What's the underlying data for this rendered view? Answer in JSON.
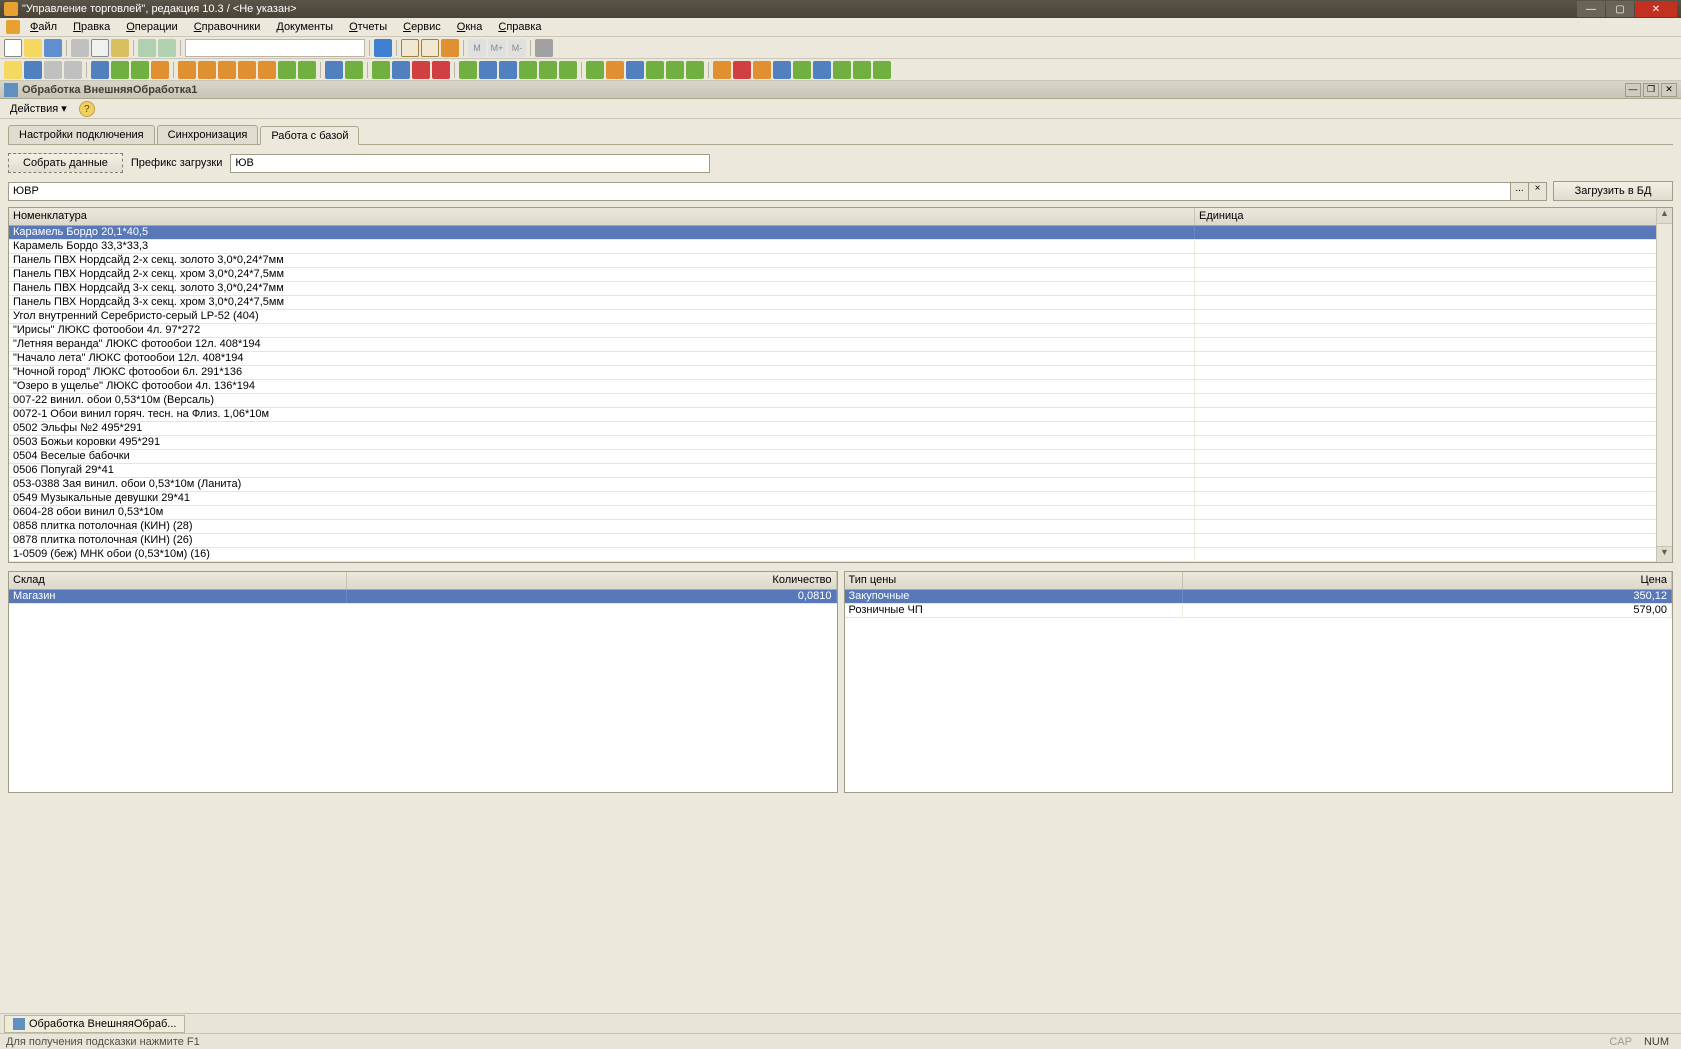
{
  "window": {
    "title": "\"Управление торговлей\", редакция 10.3 / <Не указан>"
  },
  "menu": [
    "Файл",
    "Правка",
    "Операции",
    "Справочники",
    "Документы",
    "Отчеты",
    "Сервис",
    "Окна",
    "Справка"
  ],
  "subwindow": {
    "title": "Обработка  ВнешняяОбработка1"
  },
  "actions": {
    "label": "Действия"
  },
  "tabs": [
    {
      "label": "Настройки подключения",
      "active": false
    },
    {
      "label": "Синхронизация",
      "active": false
    },
    {
      "label": "Работа с базой",
      "active": true
    }
  ],
  "form": {
    "collect_btn": "Собрать данные",
    "prefix_label": "Префикс загрузки",
    "prefix_value": "ЮВ",
    "group_value": "ЮВР",
    "load_btn": "Загрузить в БД"
  },
  "nomenclature": {
    "headers": {
      "name": "Номенклатура",
      "unit": "Единица"
    },
    "rows": [
      {
        "name": "Карамель Бордо 20,1*40,5",
        "selected": true
      },
      {
        "name": "Карамель Бордо 33,3*33,3"
      },
      {
        "name": "Панель ПВХ Нордсайд 2-х секц. золото 3,0*0,24*7мм"
      },
      {
        "name": "Панель ПВХ Нордсайд 2-х секц. хром 3,0*0,24*7,5мм"
      },
      {
        "name": "Панель ПВХ Нордсайд 3-х секц. золото 3,0*0,24*7мм"
      },
      {
        "name": "Панель ПВХ Нордсайд 3-х секц. хром 3,0*0,24*7,5мм"
      },
      {
        "name": "Угол внутренний Серебристо-серый LP-52 (404)"
      },
      {
        "name": "\"Ирисы\" ЛЮКС  фотообои 4л. 97*272"
      },
      {
        "name": "\"Летняя веранда\" ЛЮКС фотообои 12л. 408*194"
      },
      {
        "name": "\"Начало лета\" ЛЮКС фотообои 12л. 408*194"
      },
      {
        "name": "\"Ночной город\" ЛЮКС  фотообои 6л. 291*136"
      },
      {
        "name": "\"Озеро в ущелье\" ЛЮКС  фотообои 4л. 136*194"
      },
      {
        "name": "007-22 винил. обои 0,53*10м (Версаль)"
      },
      {
        "name": "0072-1 Обои винил горяч. тесн. на Флиз. 1,06*10м"
      },
      {
        "name": "0502 Эльфы №2 495*291"
      },
      {
        "name": "0503 Божьи коровки 495*291"
      },
      {
        "name": "0504 Веселые бабочки"
      },
      {
        "name": "0506 Попугай 29*41"
      },
      {
        "name": "053-0388 Зая винил. обои 0,53*10м (Ланита)"
      },
      {
        "name": "0549 Музыкальные девушки 29*41"
      },
      {
        "name": "0604-28 обои винил 0,53*10м"
      },
      {
        "name": "0858 плитка потолочная (КИН) (28)"
      },
      {
        "name": "0878 плитка потолочная (КИН) (26)"
      },
      {
        "name": "1-0509 (беж) МНК обои (0,53*10м) (16)"
      }
    ]
  },
  "warehouse": {
    "headers": {
      "wh": "Склад",
      "qty": "Количество"
    },
    "rows": [
      {
        "wh": "Магазин",
        "qty": "0,0810",
        "selected": true
      }
    ]
  },
  "prices": {
    "headers": {
      "ptype": "Тип цены",
      "price": "Цена"
    },
    "rows": [
      {
        "ptype": "Закупочные",
        "price": "350,12",
        "selected": true
      },
      {
        "ptype": "Розничные ЧП",
        "price": "579,00"
      }
    ]
  },
  "taskbar": {
    "item": "Обработка  ВнешняяОбраб..."
  },
  "status": {
    "hint": "Для получения подсказки нажмите F1",
    "cap": "CAP",
    "num": "NUM"
  }
}
